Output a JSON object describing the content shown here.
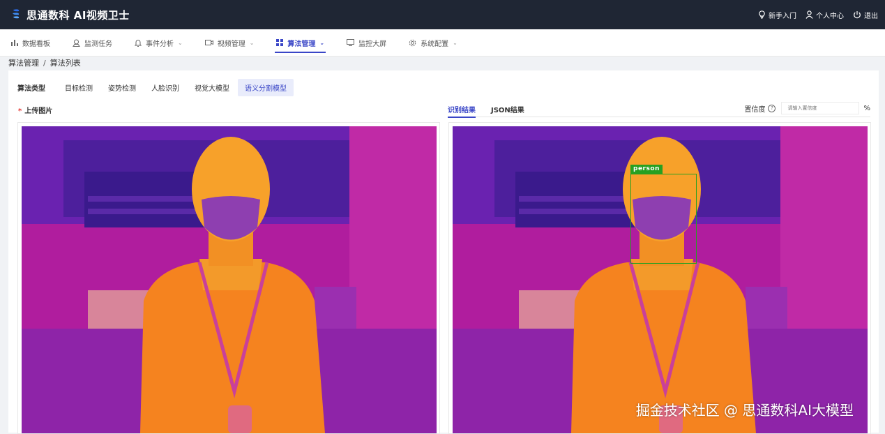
{
  "app": {
    "title": "思通数科 AI视频卫士"
  },
  "top_links": [
    {
      "label": "新手入门",
      "icon": "bulb-icon"
    },
    {
      "label": "个人中心",
      "icon": "user-icon"
    },
    {
      "label": "退出",
      "icon": "power-icon"
    }
  ],
  "nav": [
    {
      "label": "数据看板",
      "icon": "bar-chart-icon",
      "dropdown": false
    },
    {
      "label": "监测任务",
      "icon": "monitor-task-icon",
      "dropdown": false
    },
    {
      "label": "事件分析",
      "icon": "bell-icon",
      "dropdown": true
    },
    {
      "label": "视频管理",
      "icon": "video-icon",
      "dropdown": true
    },
    {
      "label": "算法管理",
      "icon": "grid-icon",
      "dropdown": true,
      "active": true
    },
    {
      "label": "监控大屏",
      "icon": "screen-icon",
      "dropdown": false
    },
    {
      "label": "系统配置",
      "icon": "gear-icon",
      "dropdown": true
    }
  ],
  "breadcrumb": {
    "root": "算法管理",
    "sep": "/",
    "current": "算法列表"
  },
  "algo_tabs": {
    "label": "算法类型",
    "items": [
      "目标检测",
      "姿势检测",
      "人脸识别",
      "视觉大模型",
      "语义分割模型"
    ],
    "active_index": 4
  },
  "upload": {
    "required_mark": "*",
    "title": "上传图片"
  },
  "result_tabs": {
    "items": [
      "识别结果",
      "JSON结果"
    ],
    "active_index": 0
  },
  "confidence": {
    "label": "置信度",
    "help": "?",
    "placeholder": "请输入置信度",
    "unit": "%"
  },
  "detection": {
    "label": "person",
    "color": "#27a021"
  },
  "watermark": "掘金技术社区 @ 思通数科AI大模型",
  "colors": {
    "topbar": "#1f2634",
    "accent": "#3a46c7"
  }
}
